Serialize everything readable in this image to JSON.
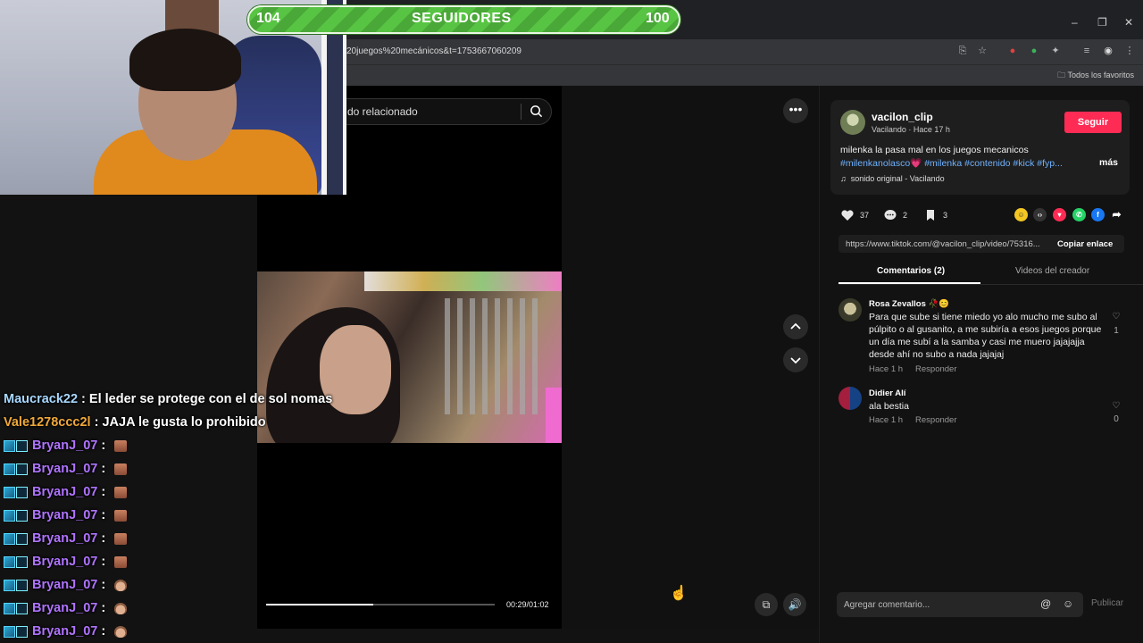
{
  "browser": {
    "url": "20juegos%20mecánicos&t=1753667060209",
    "bookmarks_label": "Todos los favoritos"
  },
  "search": {
    "placeholder": "do relacionado"
  },
  "player": {
    "time": "00:29/01:02",
    "progress_percent": 47
  },
  "post": {
    "username": "vacilon_clip",
    "subline": "Vacilando · Hace 17 h",
    "follow_label": "Seguir",
    "caption": "milenka la pasa mal en los juegos mecanicos",
    "hashtags": "#milenkanolasco💗 #milenka #contenido #kick #fyp...",
    "more_label": "más",
    "sound": "sonido original - Vacilando",
    "likes": "37",
    "comments_count": "2",
    "saves": "3",
    "link": "https://www.tiktok.com/@vacilon_clip/video/75316...",
    "copy_label": "Copiar enlace",
    "tabs": [
      {
        "label": "Comentarios (2)",
        "active": true
      },
      {
        "label": "Videos del creador",
        "active": false
      }
    ]
  },
  "comments": [
    {
      "name": "Rosa Zevallos 🥀😊",
      "text": "Para que sube si tiene miedo yo alo mucho me subo al púlpito o al gusanito, a me subiría a esos juegos porque un día me subí a la samba y casi me muero jajajajja desde ahí no subo a nada jajajaj",
      "time": "Hace 1 h",
      "reply": "Responder",
      "likes": "1"
    },
    {
      "name": "Didier Alí",
      "text": "ala bestia",
      "time": "Hace 1 h",
      "reply": "Responder",
      "likes": "0"
    }
  ],
  "comment_box": {
    "placeholder": "Agregar comentario...",
    "publish_label": "Publicar"
  },
  "goal": {
    "current": "104",
    "title": "SEGUIDORES",
    "target": "100",
    "accent": "#58c443"
  },
  "chat": [
    {
      "user": "Maucrack22",
      "color": "#a8d8ff",
      "sep": " : ",
      "msg": "El leder se protege con el de sol nomas",
      "badges": false
    },
    {
      "user": "Vale1278ccc2l",
      "color": "#f0a93a",
      "sep": " : ",
      "msg": "JAJA le gusta lo prohibido",
      "badges": false
    },
    {
      "user": "BryanJ_07",
      "color": "#b074ff",
      "sep": " : ",
      "msg": "",
      "badges": true,
      "emote": "block"
    },
    {
      "user": "BryanJ_07",
      "color": "#b074ff",
      "sep": " : ",
      "msg": "",
      "badges": true,
      "emote": "block"
    },
    {
      "user": "BryanJ_07",
      "color": "#b074ff",
      "sep": " : ",
      "msg": "",
      "badges": true,
      "emote": "block"
    },
    {
      "user": "BryanJ_07",
      "color": "#b074ff",
      "sep": " : ",
      "msg": "",
      "badges": true,
      "emote": "block"
    },
    {
      "user": "BryanJ_07",
      "color": "#b074ff",
      "sep": " : ",
      "msg": "",
      "badges": true,
      "emote": "block"
    },
    {
      "user": "BryanJ_07",
      "color": "#b074ff",
      "sep": " : ",
      "msg": "",
      "badges": true,
      "emote": "block"
    },
    {
      "user": "BryanJ_07",
      "color": "#b074ff",
      "sep": " : ",
      "msg": "",
      "badges": true,
      "emote": "hand"
    },
    {
      "user": "BryanJ_07",
      "color": "#b074ff",
      "sep": " : ",
      "msg": "",
      "badges": true,
      "emote": "hand"
    },
    {
      "user": "BryanJ_07",
      "color": "#b074ff",
      "sep": " : ",
      "msg": "",
      "badges": true,
      "emote": "hand"
    }
  ],
  "colors": {
    "follow": "#fe2c55",
    "hashtag": "#6fb2ff"
  }
}
